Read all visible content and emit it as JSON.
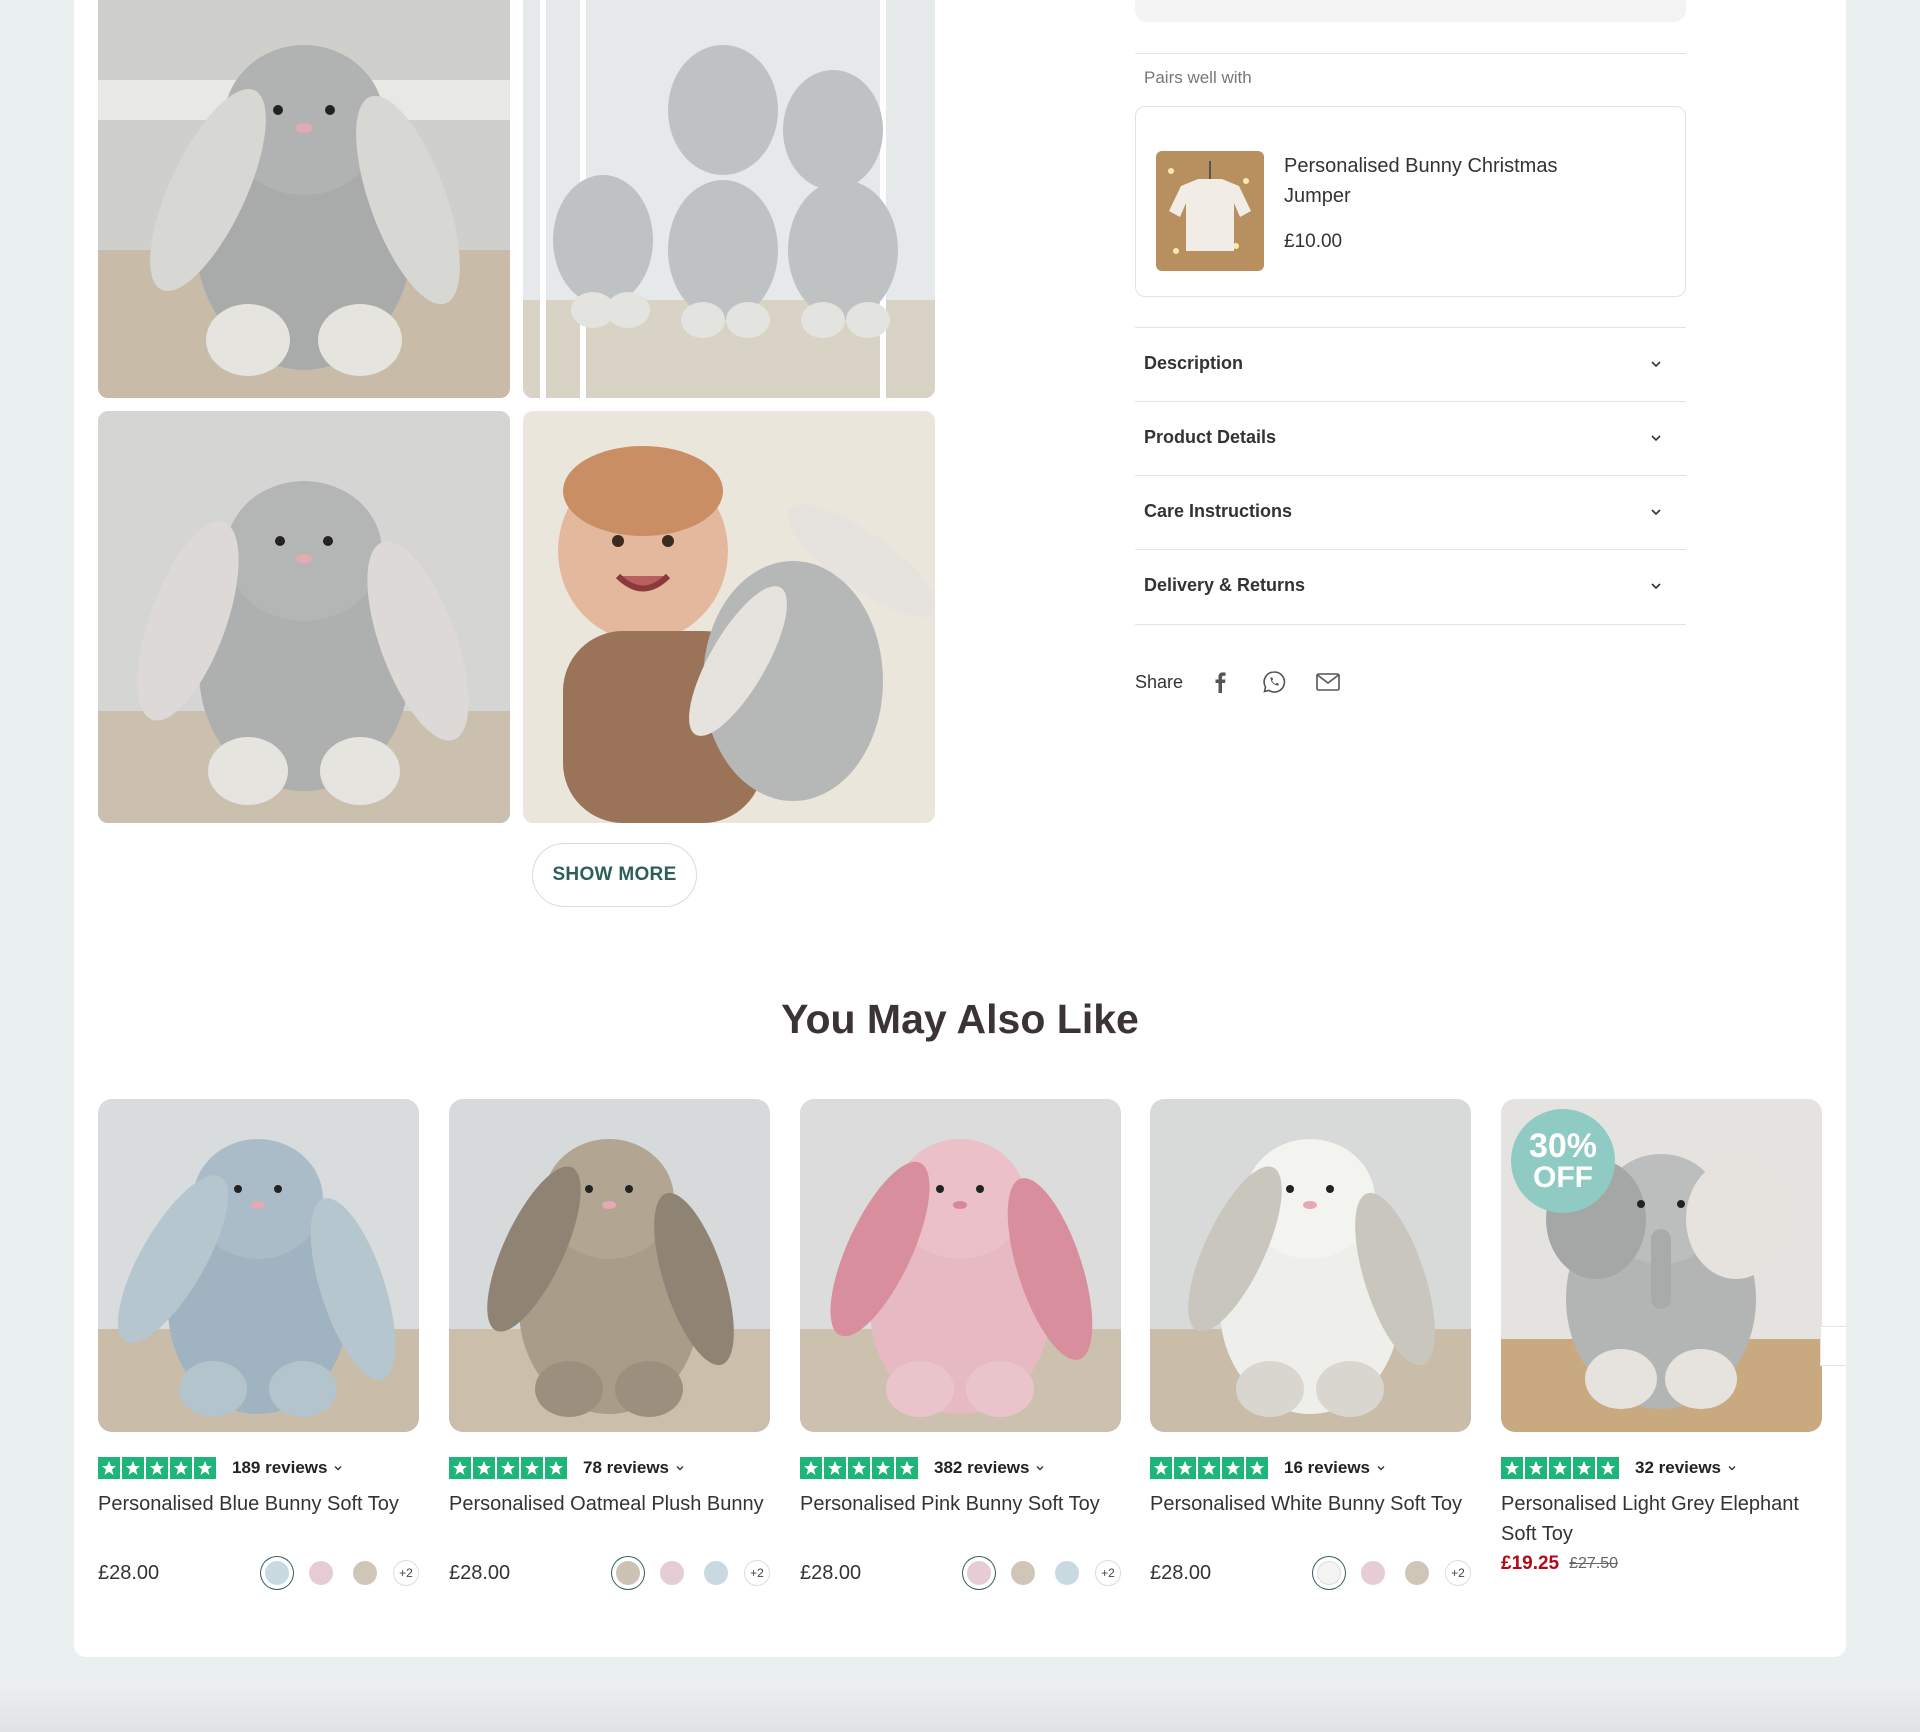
{
  "pairs_well_with": {
    "title": "Pairs well with",
    "product": {
      "name": "Personalised Bunny Christmas Jumper",
      "price": "£10.00"
    }
  },
  "accordion": [
    {
      "label": "Description"
    },
    {
      "label": "Product Details"
    },
    {
      "label": "Care Instructions"
    },
    {
      "label": "Delivery & Returns"
    }
  ],
  "share": {
    "label": "Share",
    "icons": [
      "facebook-icon",
      "whatsapp-icon",
      "email-icon"
    ]
  },
  "gallery": {
    "show_more_label": "SHOW MORE"
  },
  "recommendations": {
    "title": "You May Also Like",
    "products": [
      {
        "name": "Personalised Blue Bunny Soft Toy",
        "reviews": "189 reviews",
        "price": "£28.00",
        "more_swatches": "+2",
        "swatches": [
          "#c9d9e2",
          "#e6ccd5",
          "#cfc6b7"
        ]
      },
      {
        "name": "Personalised Oatmeal Plush Bunny",
        "reviews": "78 reviews",
        "price": "£28.00",
        "more_swatches": "+2",
        "swatches": [
          "#cdc3b4",
          "#e6ccd5",
          "#c9d9e2"
        ]
      },
      {
        "name": "Personalised Pink Bunny Soft Toy",
        "reviews": "382 reviews",
        "price": "£28.00",
        "more_swatches": "+2",
        "swatches": [
          "#e6ccd5",
          "#cfc6b7",
          "#c9d9e2"
        ]
      },
      {
        "name": "Personalised White Bunny Soft Toy",
        "reviews": "16 reviews",
        "price": "£28.00",
        "more_swatches": "+2",
        "swatches": [
          "#f4f4f2",
          "#e6ccd5",
          "#cfc6b7"
        ]
      },
      {
        "name": "Personalised Light Grey Elephant Soft Toy",
        "reviews": "32 reviews",
        "sale_price": "£19.25",
        "original_price": "£27.50",
        "badge_line1": "30%",
        "badge_line2": "OFF"
      }
    ]
  },
  "colors": {
    "accent": "#2d5f5a",
    "trustpilot_green": "#1db578",
    "sale_red": "#b20a18",
    "page_bg": "#e9f0ef"
  }
}
